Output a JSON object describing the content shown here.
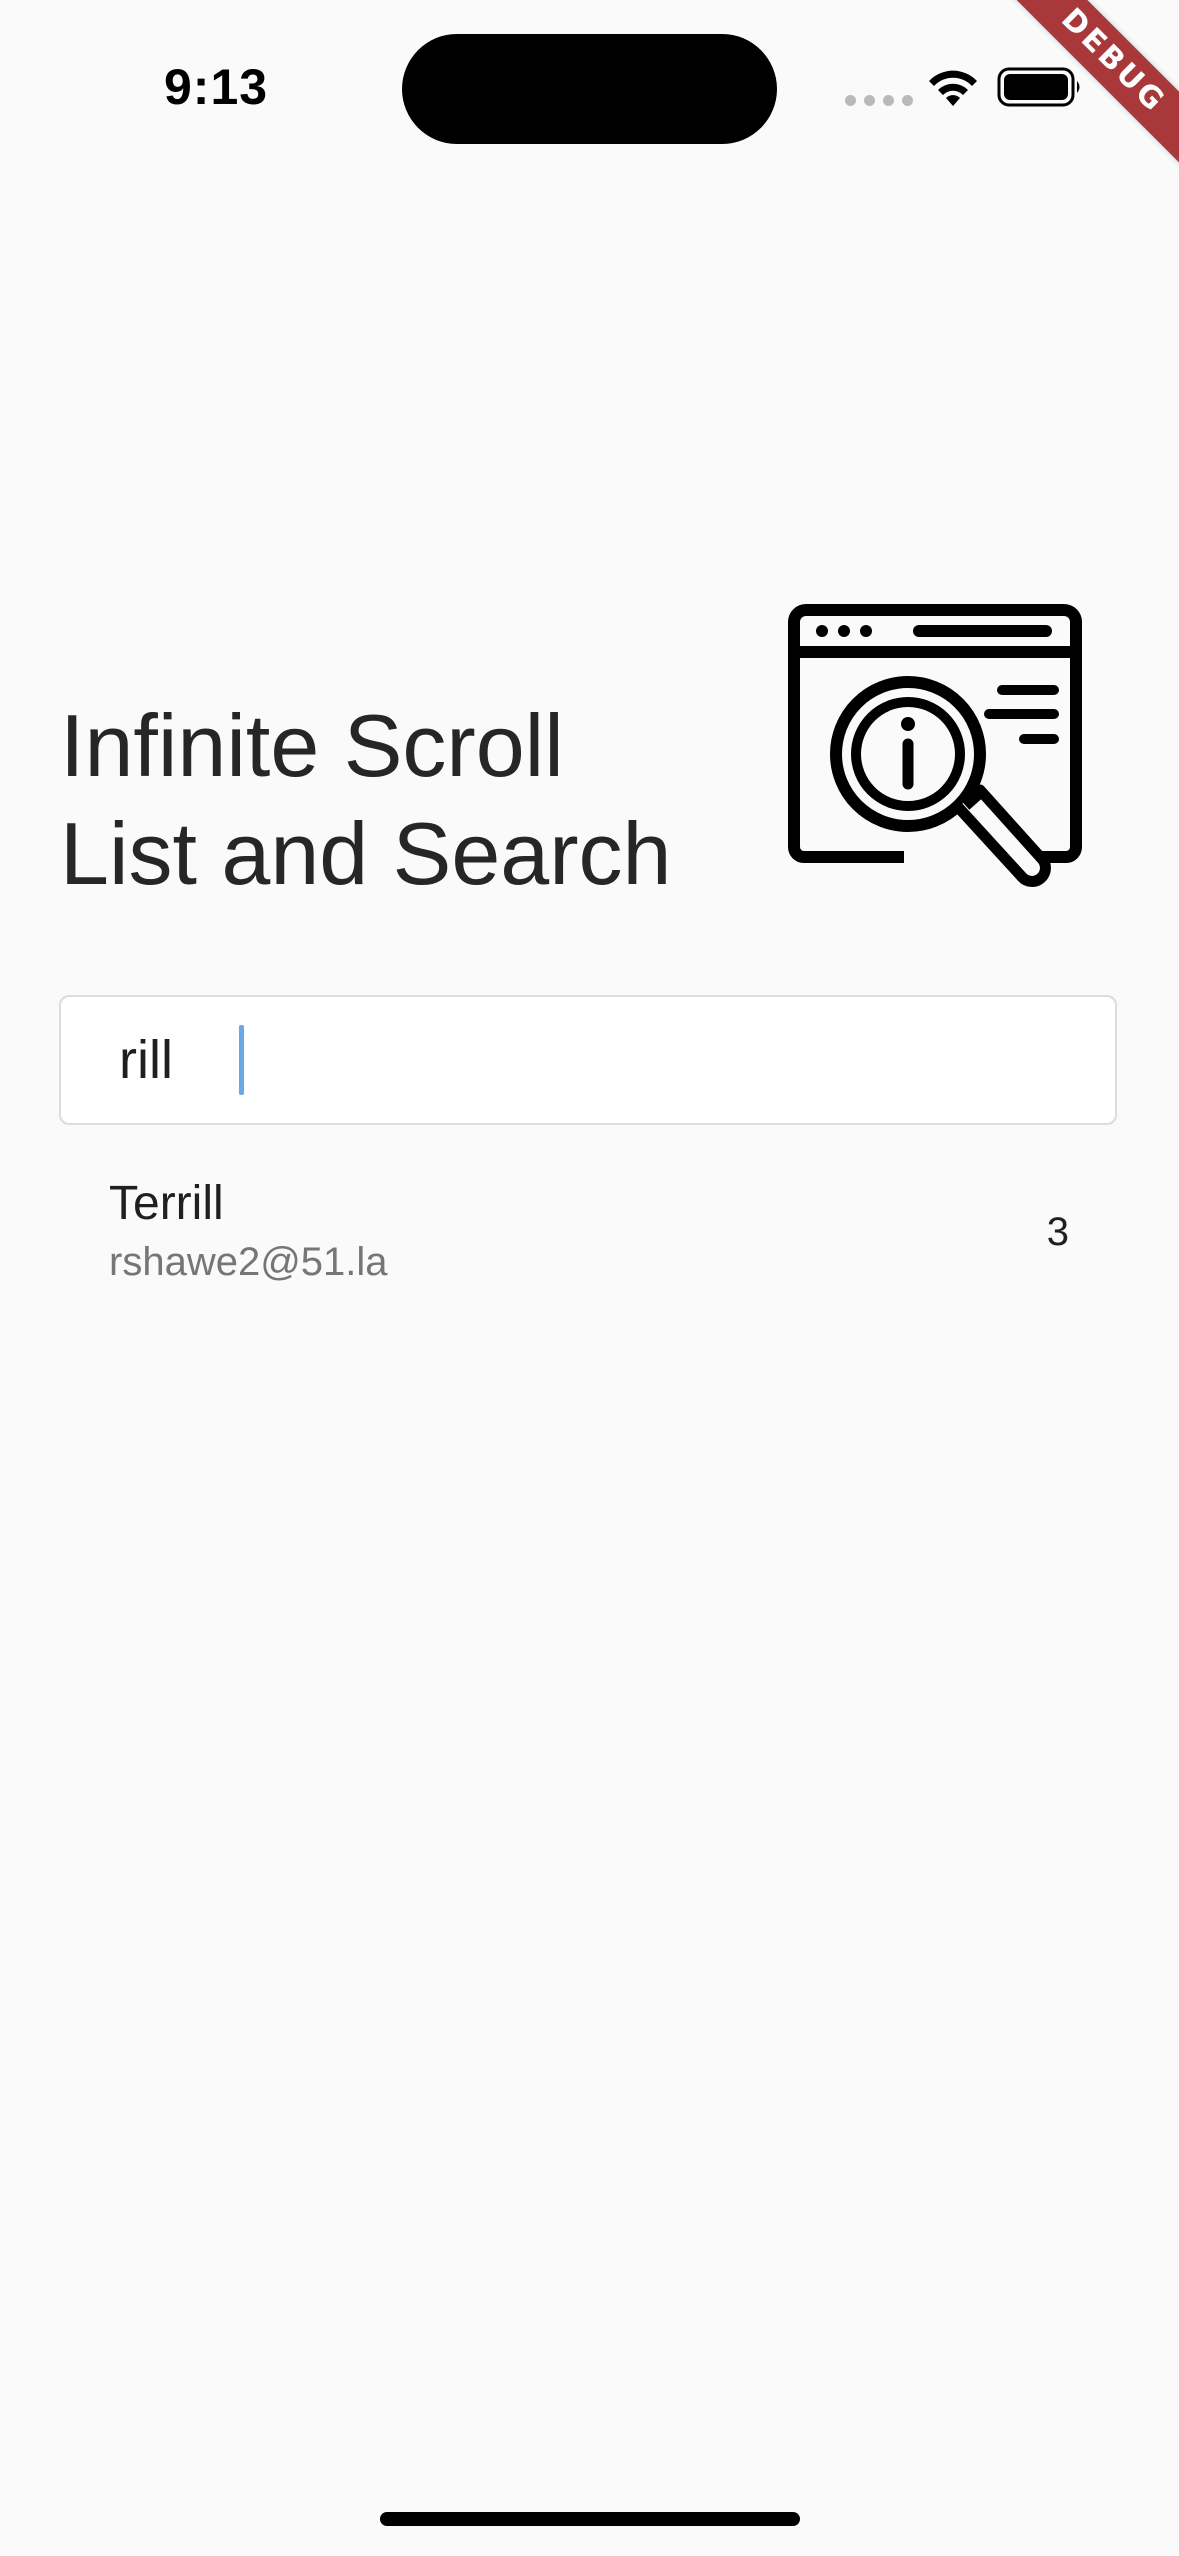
{
  "status_bar": {
    "time": "9:13"
  },
  "debug_banner": "DEBUG",
  "header": {
    "title_line_1": "Infinite Scroll",
    "title_line_2": "List and Search",
    "illustration_icon": "browser-magnifier-info-icon"
  },
  "search": {
    "value": "rill",
    "placeholder": ""
  },
  "results": [
    {
      "name": "Terrill",
      "email": "rshawe2@51.la",
      "count": "3"
    }
  ],
  "colors": {
    "background": "#fafafa",
    "caret": "#6aa7e8",
    "debug_ribbon": "#a8383a"
  }
}
